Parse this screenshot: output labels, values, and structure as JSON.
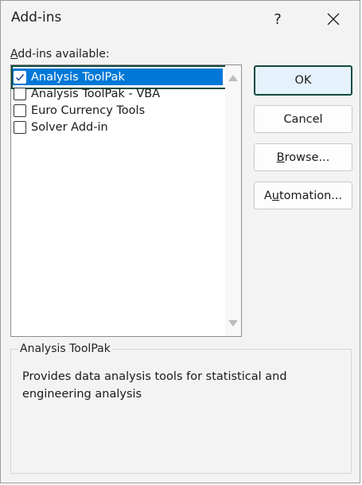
{
  "window": {
    "title": "Add-ins",
    "help_label": "?"
  },
  "addins": {
    "label_prefix": "A",
    "label_rest": "dd-ins available:",
    "items": [
      {
        "label": "Analysis ToolPak",
        "checked": true,
        "selected": true
      },
      {
        "label": "Analysis ToolPak - VBA",
        "checked": false,
        "selected": false
      },
      {
        "label": "Euro Currency Tools",
        "checked": false,
        "selected": false
      },
      {
        "label": "Solver Add-in",
        "checked": false,
        "selected": false
      }
    ]
  },
  "buttons": {
    "ok": "OK",
    "cancel": "Cancel",
    "browse_prefix": "B",
    "browse_rest": "rowse...",
    "automation_prefix": "A",
    "automation_u": "u",
    "automation_rest": "tomation..."
  },
  "description": {
    "title": "Analysis ToolPak",
    "text": "Provides data analysis tools for statistical and engineering analysis"
  },
  "colors": {
    "selection": "#0078d7",
    "focus": "#114a3f",
    "background": "#f3f3f3"
  }
}
